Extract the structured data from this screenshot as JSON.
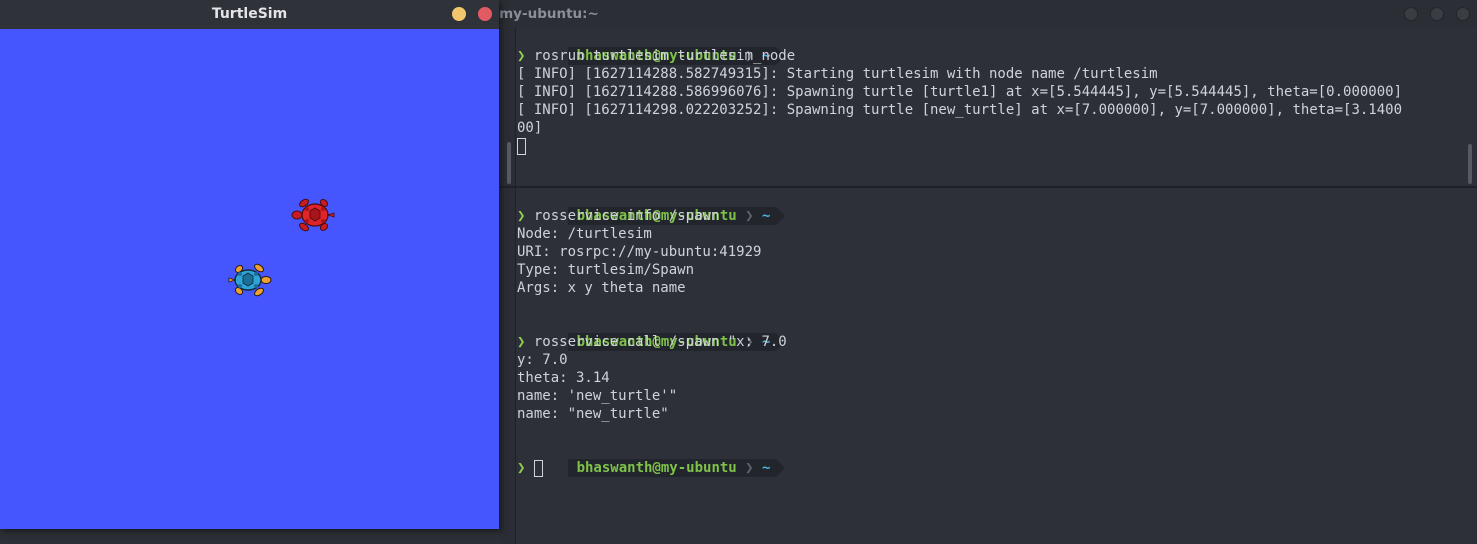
{
  "terminal": {
    "title": "n@my-ubuntu:~",
    "top_pane": {
      "prompt_user": "bhaswanth@my-ubuntu",
      "prompt_dir": "~",
      "command": "rosrun turtlesim turtlesim_node",
      "output": [
        "[ INFO] [1627114288.582749315]: Starting turtlesim with node name /turtlesim",
        "[ INFO] [1627114288.586996076]: Spawning turtle [turtle1] at x=[5.544445], y=[5.544445], theta=[0.000000]",
        "[ INFO] [1627114298.022203252]: Spawning turtle [new_turtle] at x=[7.000000], y=[7.000000], theta=[3.1400",
        "00]"
      ]
    },
    "bottom_pane": {
      "blocks": [
        {
          "prompt_user": "bhaswanth@my-ubuntu",
          "prompt_dir": "~",
          "command": "rosservice info /spawn",
          "output": [
            "Node: /turtlesim",
            "URI: rosrpc://my-ubuntu:41929",
            "Type: turtlesim/Spawn",
            "Args: x y theta name"
          ]
        },
        {
          "prompt_user": "bhaswanth@my-ubuntu",
          "prompt_dir": "~",
          "command": "rosservice call /spawn \"x: 7.0",
          "output": [
            "y: 7.0",
            "theta: 3.14",
            "name: 'new_turtle'\"",
            "name: \"new_turtle\""
          ]
        },
        {
          "prompt_user": "bhaswanth@my-ubuntu",
          "prompt_dir": "~",
          "command": ""
        }
      ]
    },
    "caret": "❯",
    "arrow": "❯"
  },
  "turtlesim": {
    "title": "TurtleSim",
    "background_color": "#4556ff",
    "turtles": [
      {
        "name": "turtle1",
        "color": "#2ea3d6"
      },
      {
        "name": "new_turtle",
        "color": "#e0242a"
      }
    ]
  }
}
